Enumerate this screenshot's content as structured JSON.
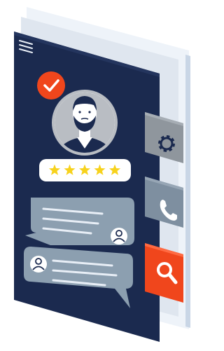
{
  "profile": {
    "verified": true,
    "rating": {
      "value": 5,
      "max": 5
    }
  },
  "messages": [
    {
      "from": "contact",
      "side": "right"
    },
    {
      "from": "user",
      "side": "left"
    }
  ],
  "side_buttons": [
    {
      "icon": "gear-icon",
      "color": "#8f969d"
    },
    {
      "icon": "phone-icon",
      "color": "#7e8fa0"
    },
    {
      "icon": "search-icon",
      "color": "#f0461c"
    }
  ],
  "colors": {
    "phone_body": "#1b2a4f",
    "back_panel": "#e8eef6",
    "check_badge": "#f0461c",
    "avatar_ring": "#b9bdc3",
    "star": "#f7d21c",
    "bubble": "#8c9fb0"
  }
}
